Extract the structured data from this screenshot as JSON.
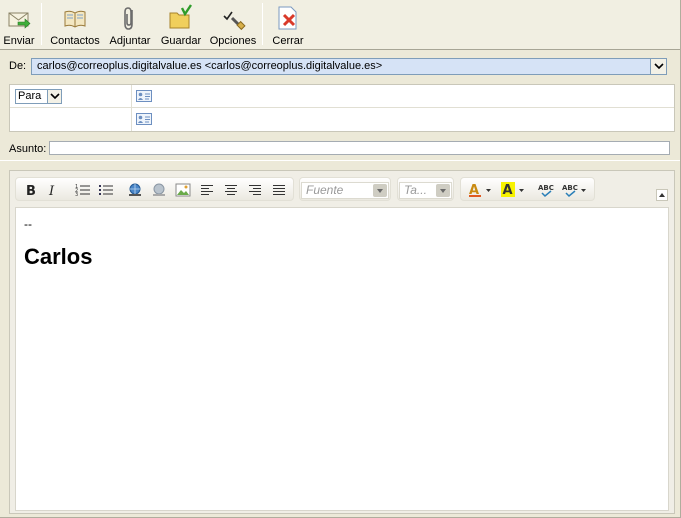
{
  "toolbar": {
    "buttons": [
      {
        "label": "Enviar",
        "icon": "send-icon"
      },
      {
        "label": "Contactos",
        "icon": "address-book-icon"
      },
      {
        "label": "Adjuntar",
        "icon": "paperclip-icon"
      },
      {
        "label": "Guardar",
        "icon": "save-folder-icon"
      },
      {
        "label": "Opciones",
        "icon": "options-checklist-icon"
      },
      {
        "label": "Cerrar",
        "icon": "close-document-icon"
      }
    ]
  },
  "header": {
    "from_label": "De:",
    "from_value": "carlos@correoplus.digitalvalue.es <carlos@correoplus.digitalvalue.es>",
    "recipient_type": "Para",
    "subject_label": "Asunto:",
    "subject_value": ""
  },
  "editor": {
    "font_placeholder": "Fuente",
    "size_placeholder": "Ta...",
    "body": {
      "signature_separator": "--",
      "signature_name": "Carlos"
    }
  },
  "colors": {
    "from_highlight": "#d6e3f6",
    "window_bg": "#ece9d8"
  }
}
